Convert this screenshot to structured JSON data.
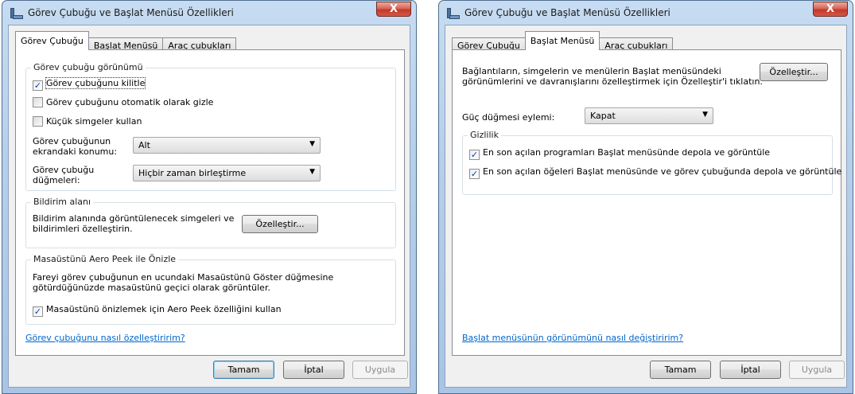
{
  "left_window": {
    "title": "Görev Çubuğu ve Başlat Menüsü Özellikleri",
    "close_label": "X",
    "tabs": [
      "Görev Çubuğu",
      "Başlat Menüsü",
      "Araç çubukları"
    ],
    "active_tab": "Görev Çubuğu",
    "appearance_group": {
      "label": "Görev çubuğu görünümü",
      "lock_taskbar": {
        "label": "Görev çubuğunu kilitle",
        "checked": true
      },
      "auto_hide": {
        "label": "Görev çubuğunu otomatik olarak gizle",
        "checked": false
      },
      "small_icons": {
        "label": "Küçük simgeler kullan",
        "checked": false
      },
      "location_label_1": "Görev çubuğunun",
      "location_label_2": "ekrandaki konumu:",
      "location_value": "Alt",
      "buttons_label_1": "Görev çubuğu",
      "buttons_label_2": "düğmeleri:",
      "buttons_value": "Hiçbir zaman birleştirme"
    },
    "notification_group": {
      "label": "Bildirim alanı",
      "text_1": "Bildirim alanında görüntülenecek simgeleri ve",
      "text_2": "bildirimleri özelleştirin.",
      "customize_label": "Özelleştir..."
    },
    "aero_group": {
      "label": "Masaüstünü Aero Peek ile Önizle",
      "text_1": "Fareyi görev çubuğunun en ucundaki Masaüstünü Göster düğmesine",
      "text_2": "götürdüğünüzde masaüstünü geçici olarak görüntüler.",
      "use_peek": {
        "label": "Masaüstünü önizlemek için Aero Peek özelliğini kullan",
        "checked": true
      }
    },
    "help_link": "Görev çubuğunu nasıl özelleştiririm?",
    "buttons": {
      "ok": "Tamam",
      "cancel": "İptal",
      "apply": "Uygula"
    }
  },
  "right_window": {
    "title": "Görev Çubuğu ve Başlat Menüsü Özellikleri",
    "close_label": "X",
    "tabs": [
      "Görev Çubuğu",
      "Başlat Menüsü",
      "Araç çubukları"
    ],
    "active_tab": "Başlat Menüsü",
    "description_1": "Bağlantıların, simgelerin ve menülerin Başlat menüsündeki",
    "description_2": "görünümlerini ve davranışlarını özelleştirmek için Özelleştir'i tıklatın.",
    "customize_label": "Özelleştir...",
    "power_label": "Güç düğmesi eylemi:",
    "power_value": "Kapat",
    "privacy_group": {
      "label": "Gizlilik",
      "recent_programs": {
        "label": "En son açılan programları Başlat menüsünde depola ve görüntüle",
        "checked": true
      },
      "recent_items": {
        "label": "En son açılan öğeleri Başlat menüsünde ve görev çubuğunda depola ve görüntüle",
        "checked": true
      }
    },
    "help_link": "Başlat menüsünün görünümünü nasıl değiştiririm?",
    "buttons": {
      "ok": "Tamam",
      "cancel": "İptal",
      "apply": "Uygula"
    }
  },
  "icons": {
    "taskbar_icon": "taskbar-properties-icon",
    "checkmark": "✓",
    "dropdown_arrow": "▼"
  }
}
